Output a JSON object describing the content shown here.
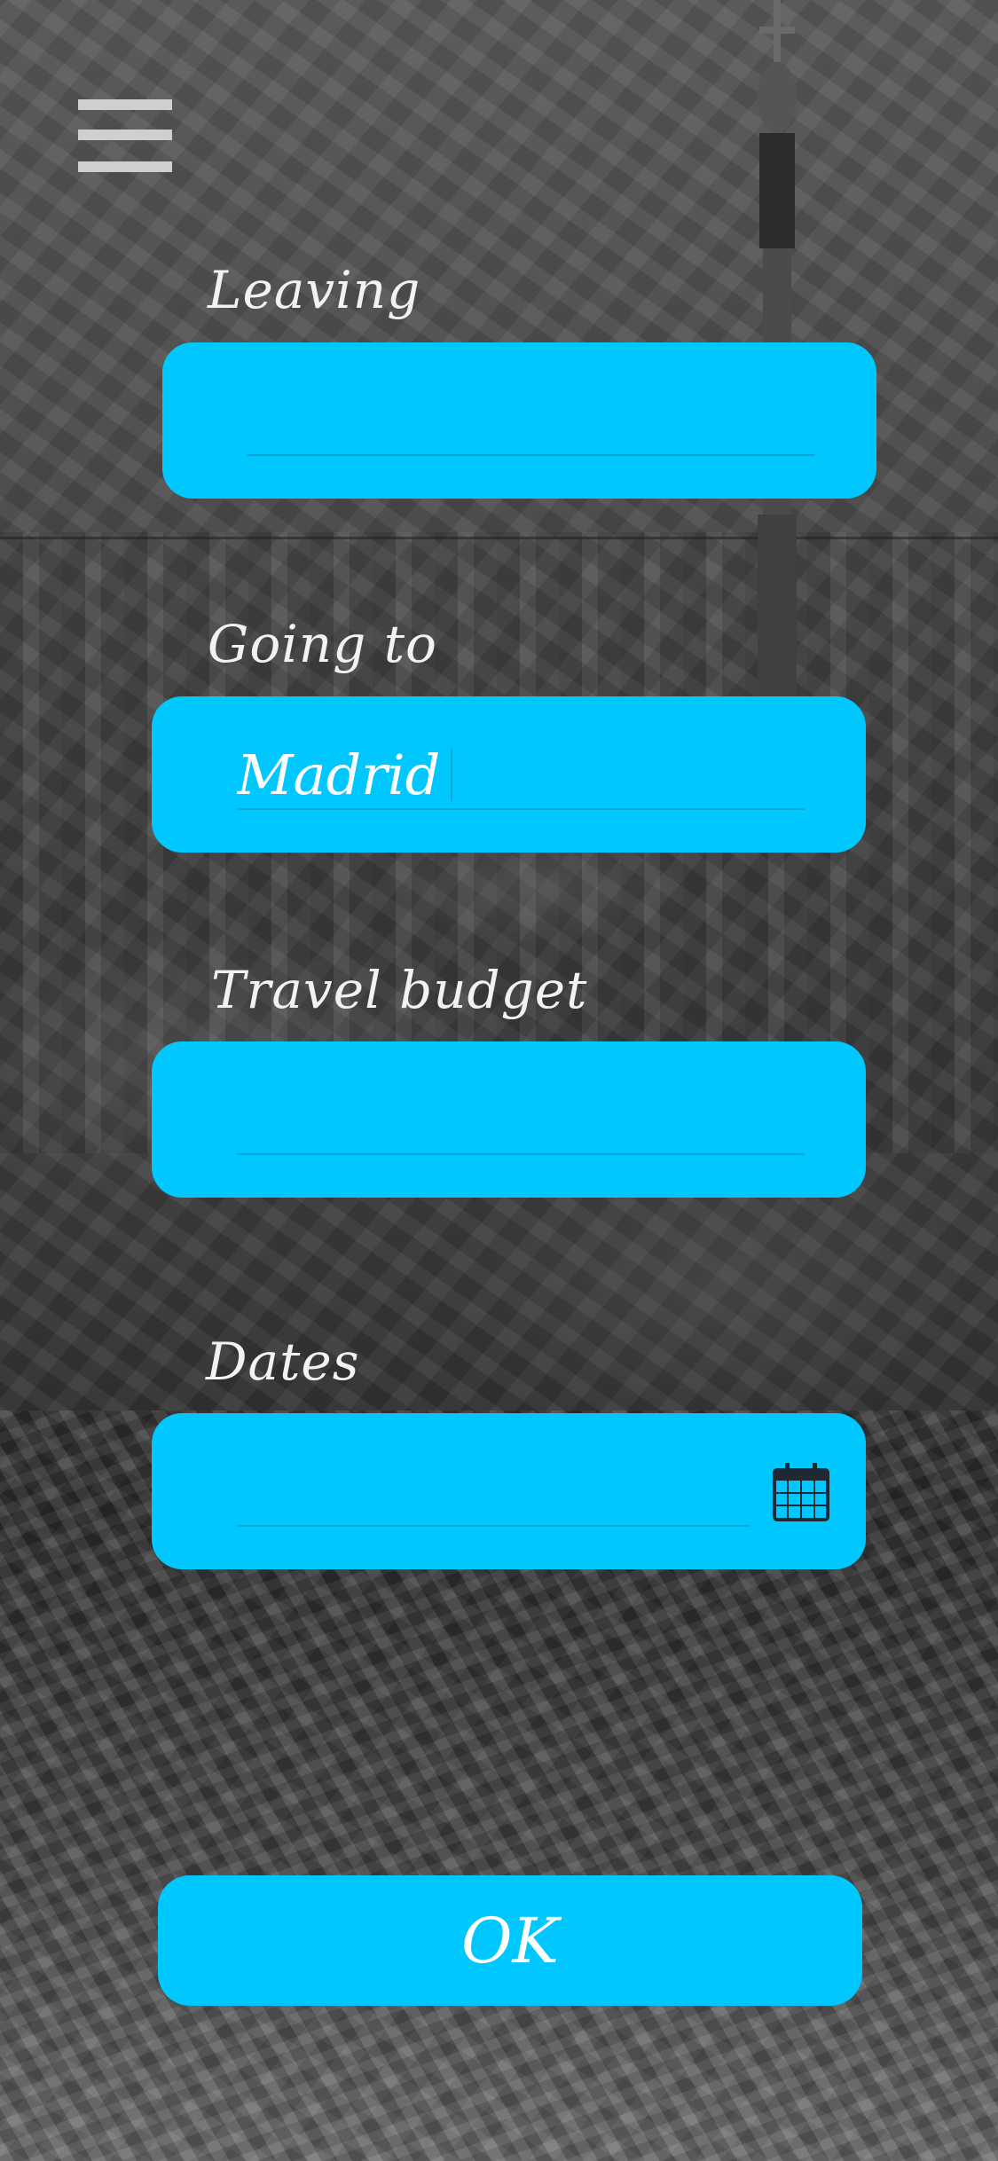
{
  "form": {
    "leaving": {
      "label": "Leaving",
      "value": ""
    },
    "going_to": {
      "label": "Going to",
      "value": "Madrid"
    },
    "budget": {
      "label": "Travel budget",
      "value": ""
    },
    "dates": {
      "label": "Dates",
      "value": "",
      "icon": "calendar-icon"
    }
  },
  "actions": {
    "ok_label": "OK"
  },
  "menu": {
    "icon": "hamburger-menu-icon"
  },
  "colors": {
    "accent": "#00c8ff",
    "underline": "#0aa6d8",
    "label_text": "#f2f2f2"
  }
}
